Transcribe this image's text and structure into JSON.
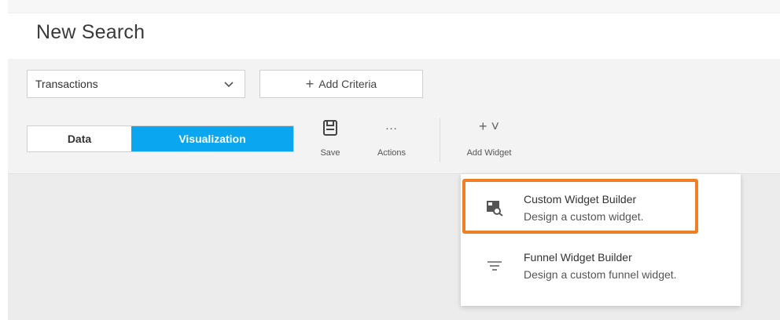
{
  "header": {
    "title": "New Search"
  },
  "criteria": {
    "select_value": "Transactions",
    "add_label": "Add Criteria"
  },
  "toolbar": {
    "tabs": [
      {
        "label": "Data",
        "active": false
      },
      {
        "label": "Visualization",
        "active": true
      }
    ],
    "save_label": "Save",
    "actions_label": "Actions",
    "actions_icon": "…",
    "add_widget_label": "Add Widget",
    "add_widget_icon": "+ ˅"
  },
  "menu": {
    "items": [
      {
        "title": "Custom Widget Builder",
        "description": "Design a custom widget.",
        "icon": "widget-builder-icon",
        "highlighted": true
      },
      {
        "title": "Funnel Widget Builder",
        "description": "Design a custom funnel widget.",
        "icon": "funnel-icon",
        "highlighted": false
      }
    ]
  },
  "colors": {
    "accent": "#0aa6ef",
    "highlight": "#ef7f24"
  }
}
